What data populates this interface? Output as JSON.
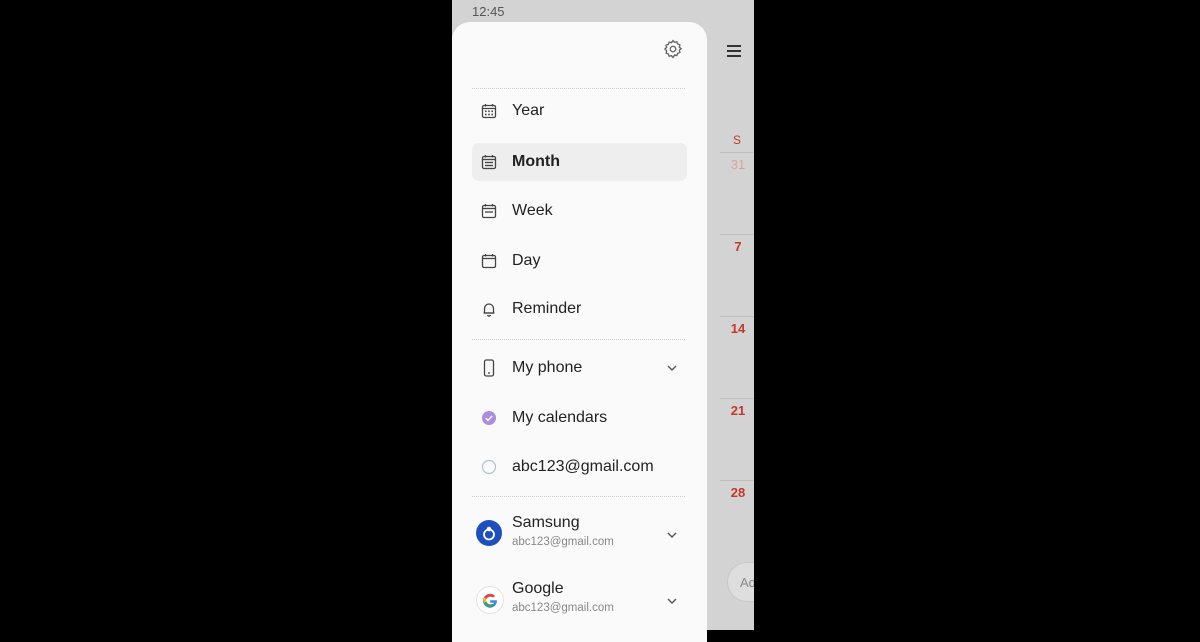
{
  "status_bar": {
    "time": "12:45"
  },
  "background_calendar": {
    "day_header": "S",
    "dates": [
      {
        "label": "31",
        "faded": true
      },
      {
        "label": "7",
        "faded": false
      },
      {
        "label": "14",
        "faded": false
      },
      {
        "label": "21",
        "faded": false
      },
      {
        "label": "28",
        "faded": false
      }
    ],
    "add_placeholder": "Ad"
  },
  "drawer": {
    "views": [
      {
        "label": "Year",
        "icon": "calendar-grid-icon",
        "selected": false
      },
      {
        "label": "Month",
        "icon": "calendar-month-icon",
        "selected": true
      },
      {
        "label": "Week",
        "icon": "calendar-week-icon",
        "selected": false
      },
      {
        "label": "Day",
        "icon": "calendar-day-icon",
        "selected": false
      },
      {
        "label": "Reminder",
        "icon": "bell-icon",
        "selected": false
      }
    ],
    "my_phone_label": "My phone",
    "calendars": [
      {
        "label": "My calendars",
        "checked": true
      },
      {
        "label": "abc123@gmail.com",
        "checked": false
      }
    ],
    "accounts": [
      {
        "name": "Samsung",
        "email": "abc123@gmail.com"
      },
      {
        "name": "Google",
        "email": "abc123@gmail.com"
      }
    ]
  },
  "colors": {
    "accent_purple": "#a98de0",
    "weekend_red": "#c0392b",
    "samsung_blue": "#1f4fbf",
    "selected_bg": "#eeeeee"
  }
}
